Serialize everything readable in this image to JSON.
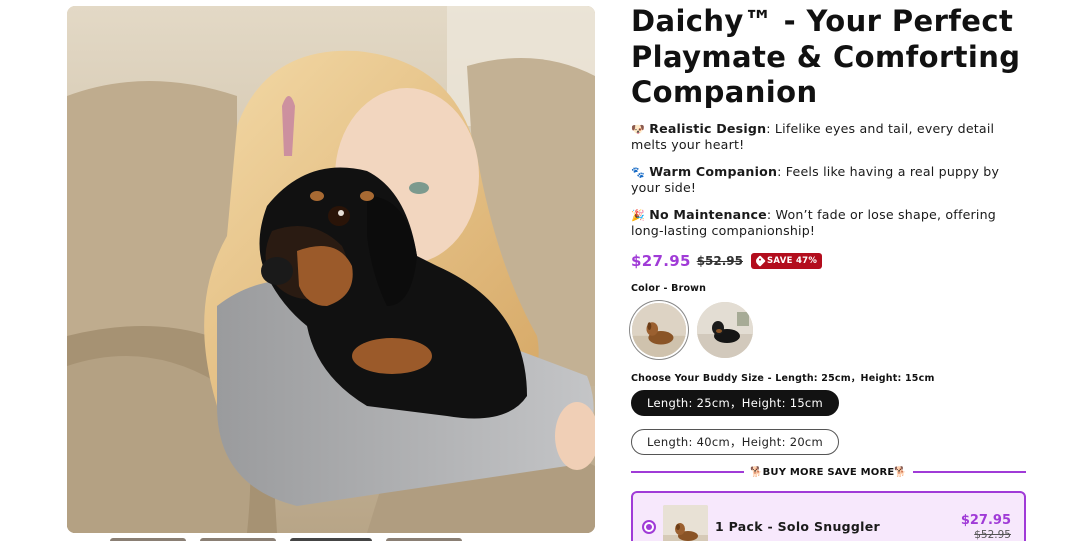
{
  "product": {
    "title": "Daichy™ - Your Perfect Playmate & Comforting Companion",
    "image_alt": "Girl hugging a black and tan dachshund plush on a sofa"
  },
  "features": [
    {
      "emoji": "🐶",
      "heading": "Realistic Design",
      "text": ": Lifelike eyes and tail, every detail melts your heart!"
    },
    {
      "emoji": "🐾",
      "heading": "Warm Companion",
      "text": ": Feels like having a real puppy by your side!"
    },
    {
      "emoji": "🎉",
      "heading": "No Maintenance",
      "text": ": Won’t fade or lose shape, offering long-lasting companionship!"
    }
  ],
  "pricing": {
    "current": "$27.95",
    "original": "$52.95",
    "badge": "SAVE 47%"
  },
  "color_option": {
    "label": "Color - Brown",
    "swatches": [
      {
        "name": "Brown",
        "selected": true
      },
      {
        "name": "Black",
        "selected": false
      }
    ]
  },
  "size_option": {
    "label": "Choose Your Buddy Size - Length: 25cm，Height: 15cm",
    "choices": [
      {
        "label": "Length: 25cm，Height: 15cm",
        "active": true
      },
      {
        "label": "Length: 40cm，Height: 20cm",
        "active": false
      }
    ]
  },
  "bundle": {
    "divider": "🐕BUY MORE SAVE MORE🐕",
    "offers": [
      {
        "name": "1 Pack - Solo Snuggler",
        "price": "$27.95",
        "compare": "$52.95",
        "selected": true
      }
    ]
  },
  "colors": {
    "accent": "#a03bd7",
    "badge": "#b30d1d",
    "selected_bundle_bg": "#f7e8fc"
  }
}
